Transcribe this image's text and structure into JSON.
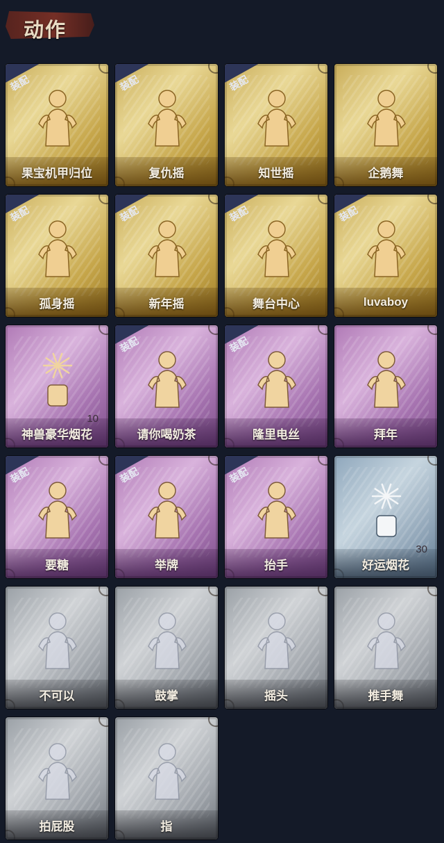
{
  "section": {
    "title": "动作"
  },
  "badge_label": "装配",
  "colors": {
    "gold": "#d2b85f",
    "purple": "#b886bf",
    "blue": "#a3b9cb",
    "gray": "#b3b7bc",
    "background": "#141a28"
  },
  "actions": [
    {
      "name": "果宝机甲归位",
      "tier": "gold",
      "equipped": true,
      "icon": "figure-arms-crossed-icon"
    },
    {
      "name": "复仇摇",
      "tier": "gold",
      "equipped": true,
      "icon": "figure-pointing-up-icon"
    },
    {
      "name": "知世摇",
      "tier": "gold",
      "equipped": true,
      "icon": "figure-dancing-icon"
    },
    {
      "name": "企鹅舞",
      "tier": "gold",
      "equipped": false,
      "icon": "figure-penguin-dance-icon"
    },
    {
      "name": "孤身摇",
      "tier": "gold",
      "equipped": true,
      "icon": "figure-sway-icon"
    },
    {
      "name": "新年摇",
      "tier": "gold",
      "equipped": true,
      "icon": "figure-clap-icon"
    },
    {
      "name": "舞台中心",
      "tier": "gold",
      "equipped": true,
      "icon": "figure-center-stage-icon"
    },
    {
      "name": "luvaboy",
      "tier": "gold",
      "equipped": true,
      "icon": "figure-pose-icon"
    },
    {
      "name": "神兽豪华烟花",
      "tier": "purple",
      "equipped": false,
      "icon": "fireworks-box-icon",
      "count": "10"
    },
    {
      "name": "请你喝奶茶",
      "tier": "purple",
      "equipped": true,
      "icon": "figure-milk-tea-icon"
    },
    {
      "name": "隆里电丝",
      "tier": "purple",
      "equipped": true,
      "icon": "figure-disco-icon"
    },
    {
      "name": "拜年",
      "tier": "purple",
      "equipped": false,
      "icon": "figure-bow-icon"
    },
    {
      "name": "要糖",
      "tier": "purple",
      "equipped": true,
      "icon": "figure-ask-candy-icon"
    },
    {
      "name": "举牌",
      "tier": "purple",
      "equipped": true,
      "icon": "figure-hold-sign-icon"
    },
    {
      "name": "抬手",
      "tier": "purple",
      "equipped": true,
      "icon": "figure-raise-hand-icon"
    },
    {
      "name": "好运烟花",
      "tier": "blue",
      "equipped": false,
      "icon": "firework-can-icon",
      "count": "30"
    },
    {
      "name": "不可以",
      "tier": "gray",
      "equipped": false,
      "icon": "finger-wag-icon"
    },
    {
      "name": "鼓掌",
      "tier": "gray",
      "equipped": false,
      "icon": "clapping-hands-icon"
    },
    {
      "name": "摇头",
      "tier": "gray",
      "equipped": false,
      "icon": "figure-shake-head-icon"
    },
    {
      "name": "推手舞",
      "tier": "gray",
      "equipped": false,
      "icon": "figure-push-dance-icon"
    },
    {
      "name": "拍屁股",
      "tier": "gray",
      "equipped": false,
      "icon": "figure-bum-pat-icon"
    },
    {
      "name": "指",
      "tier": "gray",
      "equipped": false,
      "icon": "pointing-hand-icon"
    }
  ]
}
